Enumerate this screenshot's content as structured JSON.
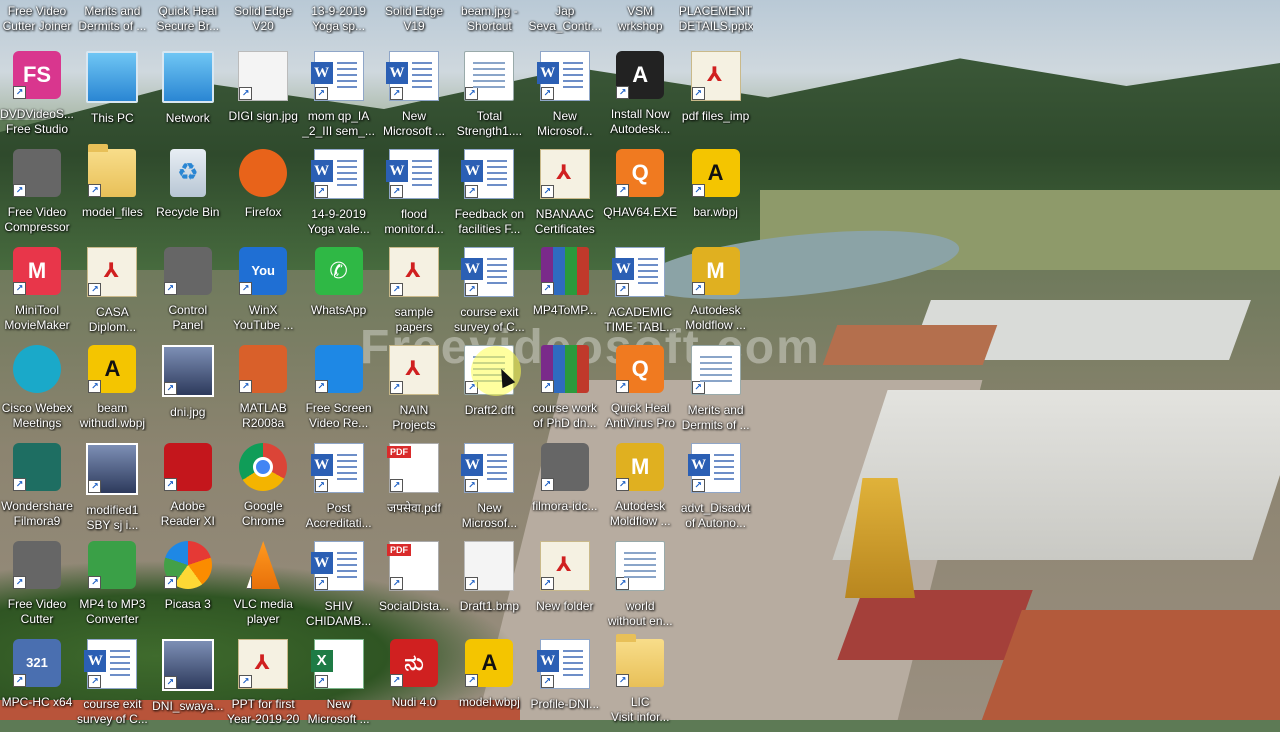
{
  "watermark": "Freevideosoft.com",
  "top_row": [
    {
      "line1": "Free Video",
      "line2": "Cutter Joiner"
    },
    {
      "line1": "Merits and",
      "line2": "Dermits of ..."
    },
    {
      "line1": "Quick Heal",
      "line2": "Secure Br..."
    },
    {
      "line1": "Solid Edge",
      "line2": "V20"
    },
    {
      "line1": "13-9-2019",
      "line2": "Yoga sp..."
    },
    {
      "line1": "Solid Edge",
      "line2": "V19"
    },
    {
      "line1": "beam.jpg -",
      "line2": "Shortcut"
    },
    {
      "line1": "Jap",
      "line2": "Seva_Contr..."
    },
    {
      "line1": "VSM",
      "line2": "wrkshop"
    },
    {
      "line1": "PLACEMENT",
      "line2": "DETAILS.pptx"
    }
  ],
  "icons": [
    {
      "line1": "DVDVideoS...",
      "line2": "Free Studio",
      "glyph": "FS",
      "icon": "dvdvideosoft-icon",
      "color": "#d9368e"
    },
    {
      "line1": "This PC",
      "line2": "",
      "icon": "computer-icon"
    },
    {
      "line1": "Network",
      "line2": "",
      "icon": "network-icon"
    },
    {
      "line1": "DIGI sign.jpg",
      "line2": "",
      "icon": "image-file-icon"
    },
    {
      "line1": "mom qp_IA",
      "line2": "_2_III sem_...",
      "icon": "word-document-icon"
    },
    {
      "line1": "New",
      "line2": "Microsoft ...",
      "icon": "word-document-icon"
    },
    {
      "line1": "Total",
      "line2": "Strength1....",
      "icon": "document-icon"
    },
    {
      "line1": "New",
      "line2": "Microsof...",
      "icon": "word-document-icon"
    },
    {
      "line1": "Install Now",
      "line2": "Autodesk...",
      "glyph": "A",
      "icon": "autodesk-installer-icon",
      "color": "#222222"
    },
    {
      "line1": "pdf files_imp",
      "line2": "",
      "icon": "pdf-folder-icon"
    },
    {
      "line1": "Free Video",
      "line2": "Compressor",
      "icon": "video-compressor-icon"
    },
    {
      "line1": "model_files",
      "line2": "",
      "icon": "folder-icon"
    },
    {
      "line1": "Recycle Bin",
      "line2": "",
      "icon": "recycle-bin-icon"
    },
    {
      "line1": "Firefox",
      "line2": "",
      "icon": "firefox-icon",
      "color": "#e8631a"
    },
    {
      "line1": "14-9-2019",
      "line2": "Yoga vale...",
      "icon": "word-document-icon"
    },
    {
      "line1": "flood",
      "line2": "monitor.d...",
      "icon": "word-document-icon"
    },
    {
      "line1": "Feedback on",
      "line2": "facilities F...",
      "icon": "word-document-icon"
    },
    {
      "line1": "NBANAAC",
      "line2": "Certificates",
      "icon": "pdf-folder-icon"
    },
    {
      "line1": "QHAV64.EXE",
      "line2": "",
      "glyph": "Q",
      "icon": "quickheal-icon",
      "color": "#f07a20"
    },
    {
      "line1": "bar.wbpj",
      "line2": "",
      "glyph": "A",
      "icon": "ansys-workbench-icon",
      "color": "#f4c500"
    },
    {
      "line1": "MiniTool",
      "line2": "MovieMaker",
      "glyph": "M",
      "icon": "minitool-icon",
      "color": "#e8364a"
    },
    {
      "line1": "CASA",
      "line2": "Diplom...",
      "icon": "pdf-folder-icon"
    },
    {
      "line1": "Control",
      "line2": "Panel",
      "icon": "control-panel-icon"
    },
    {
      "line1": "WinX",
      "line2": "YouTube ...",
      "glyph": "You",
      "icon": "winx-youtube-icon",
      "color": "#1f6fd4"
    },
    {
      "line1": "WhatsApp",
      "line2": "",
      "glyph": "✆",
      "icon": "whatsapp-icon",
      "color": "#2fb845"
    },
    {
      "line1": "sample",
      "line2": "papers",
      "icon": "pdf-folder-icon"
    },
    {
      "line1": "course exit",
      "line2": "survey of C...",
      "icon": "word-document-icon"
    },
    {
      "line1": "MP4ToMP...",
      "line2": "",
      "icon": "winrar-archive-icon"
    },
    {
      "line1": "ACADEMIC",
      "line2": "TIME-TABL...",
      "icon": "word-document-icon"
    },
    {
      "line1": "Autodesk",
      "line2": "Moldflow ...",
      "glyph": "M",
      "icon": "moldflow-icon",
      "color": "#e0b020"
    },
    {
      "line1": "Cisco Webex",
      "line2": "Meetings",
      "icon": "webex-icon",
      "color": "#1aa9c9"
    },
    {
      "line1": "beam",
      "line2": "withudl.wbpj",
      "glyph": "A",
      "icon": "ansys-workbench-icon",
      "color": "#f4c500"
    },
    {
      "line1": "dni.jpg",
      "line2": "",
      "icon": "photo-icon"
    },
    {
      "line1": "MATLAB",
      "line2": "R2008a",
      "icon": "matlab-icon",
      "color": "#d9602a"
    },
    {
      "line1": "Free Screen",
      "line2": "Video Re...",
      "icon": "screen-recorder-icon",
      "color": "#1e88e5"
    },
    {
      "line1": "NAIN",
      "line2": "Projects",
      "icon": "pdf-folder-icon"
    },
    {
      "line1": "Draft2.dft",
      "line2": "",
      "icon": "draft-file-icon"
    },
    {
      "line1": "course work",
      "line2": "of PhD dn...",
      "icon": "winrar-archive-icon"
    },
    {
      "line1": "Quick Heal",
      "line2": "AntiVirus Pro",
      "glyph": "Q",
      "icon": "quickheal-icon",
      "color": "#f07a20"
    },
    {
      "line1": "Merits and",
      "line2": "Dermits of ...",
      "icon": "powerpoint-file-icon"
    },
    {
      "line1": "Wondershare",
      "line2": "Filmora9",
      "icon": "filmora-icon",
      "color": "#1e6e62"
    },
    {
      "line1": "modified1",
      "line2": "SBY sj i...",
      "icon": "photo-icon"
    },
    {
      "line1": "Adobe",
      "line2": "Reader XI",
      "icon": "adobe-reader-icon",
      "color": "#c4161c"
    },
    {
      "line1": "Google",
      "line2": "Chrome",
      "icon": "chrome-icon"
    },
    {
      "line1": "Post",
      "line2": "Accreditati...",
      "icon": "word-document-icon"
    },
    {
      "line1": "जपसेवा.pdf",
      "line2": "",
      "icon": "pdf-icon"
    },
    {
      "line1": "New",
      "line2": "Microsof...",
      "icon": "word-document-icon"
    },
    {
      "line1": "filmora-idc...",
      "line2": "",
      "icon": "installer-icon"
    },
    {
      "line1": "Autodesk",
      "line2": "Moldflow ...",
      "glyph": "M",
      "icon": "moldflow-icon",
      "color": "#e0b020"
    },
    {
      "line1": "advt_Disadvt",
      "line2": "of Autono...",
      "icon": "word-document-icon"
    },
    {
      "line1": "Free Video",
      "line2": "Cutter",
      "icon": "video-cutter-icon"
    },
    {
      "line1": "MP4 to MP3",
      "line2": "Converter",
      "icon": "converter-icon",
      "color": "#3aa047"
    },
    {
      "line1": "Picasa 3",
      "line2": "",
      "icon": "picasa-icon"
    },
    {
      "line1": "VLC media",
      "line2": "player",
      "icon": "vlc-icon"
    },
    {
      "line1": "SHIV",
      "line2": "CHIDAMB...",
      "icon": "word-document-icon"
    },
    {
      "line1": "SocialDista...",
      "line2": "",
      "icon": "pdf-icon"
    },
    {
      "line1": "Draft1.bmp",
      "line2": "",
      "icon": "bitmap-icon"
    },
    {
      "line1": "New folder",
      "line2": "",
      "icon": "pdf-folder-icon"
    },
    {
      "line1": "world",
      "line2": "without en...",
      "icon": "powerpoint-file-icon"
    },
    {
      "line1": "",
      "line2": "",
      "icon": "empty-slot"
    },
    {
      "line1": "MPC-HC x64",
      "line2": "",
      "glyph": "321",
      "icon": "mpc-hc-icon",
      "color": "#4a6fb0"
    },
    {
      "line1": "course exit",
      "line2": "survey of C...",
      "icon": "word-document-icon"
    },
    {
      "line1": "DNI_swaya...",
      "line2": "",
      "icon": "photo-icon"
    },
    {
      "line1": "PPT for first",
      "line2": "Year-2019-20",
      "icon": "pdf-folder-icon"
    },
    {
      "line1": "New",
      "line2": "Microsoft ...",
      "icon": "excel-document-icon"
    },
    {
      "line1": "Nudi 4.0",
      "line2": "",
      "glyph": "ನು",
      "icon": "nudi-icon",
      "color": "#d02020"
    },
    {
      "line1": "model.wbpj",
      "line2": "",
      "glyph": "A",
      "icon": "ansys-workbench-icon",
      "color": "#f4c500"
    },
    {
      "line1": "Profile-DNI...",
      "line2": "",
      "icon": "word-document-icon"
    },
    {
      "line1": "LIC",
      "line2": "Visit infor...",
      "icon": "folder-icon"
    },
    {
      "line1": "",
      "line2": "",
      "icon": "empty-slot"
    }
  ]
}
